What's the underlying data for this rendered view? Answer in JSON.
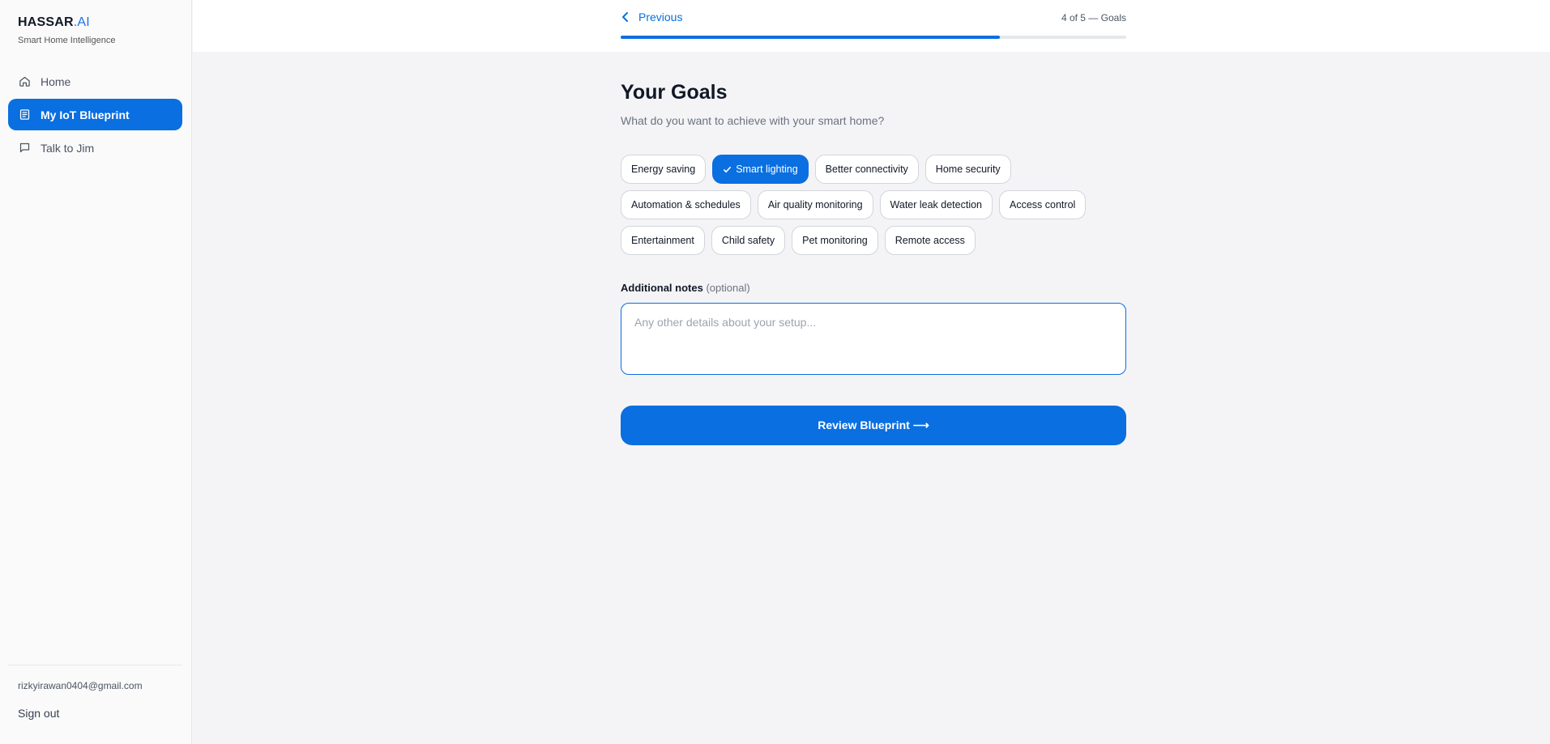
{
  "brand": {
    "name": "HASSAR",
    "suffix": ".AI",
    "tagline": "Smart Home Intelligence"
  },
  "sidebar": {
    "items": [
      {
        "label": "Home",
        "icon": "home-icon",
        "active": false
      },
      {
        "label": "My IoT Blueprint",
        "icon": "document-icon",
        "active": true
      },
      {
        "label": "Talk to Jim",
        "icon": "chat-icon",
        "active": false
      }
    ],
    "user_email": "rizkyirawan0404@gmail.com",
    "sign_out": "Sign out"
  },
  "topbar": {
    "previous": "Previous",
    "step_text": "4 of 5 — Goals",
    "progress_fraction": 0.75
  },
  "main": {
    "title": "Your Goals",
    "subtitle": "What do you want to achieve with your smart home?",
    "goal_rows": [
      [
        {
          "label": "Energy saving",
          "selected": false
        },
        {
          "label": "Smart lighting",
          "selected": true
        },
        {
          "label": "Better connectivity",
          "selected": false
        },
        {
          "label": "Home security",
          "selected": false
        }
      ],
      [
        {
          "label": "Automation & schedules",
          "selected": false
        },
        {
          "label": "Air quality monitoring",
          "selected": false
        },
        {
          "label": "Water leak detection",
          "selected": false
        },
        {
          "label": "Access control",
          "selected": false
        }
      ],
      [
        {
          "label": "Entertainment",
          "selected": false
        },
        {
          "label": "Child safety",
          "selected": false
        },
        {
          "label": "Pet monitoring",
          "selected": false
        },
        {
          "label": "Remote access",
          "selected": false
        }
      ]
    ],
    "notes_label": "Additional notes",
    "notes_optional": "(optional)",
    "notes_value": "",
    "notes_placeholder": "Any other details about your setup...",
    "review_button": "Review Blueprint ⟶"
  },
  "colors": {
    "accent": "#0a6fe0",
    "background": "#f4f4f6",
    "sidebar": "#fafafa"
  }
}
